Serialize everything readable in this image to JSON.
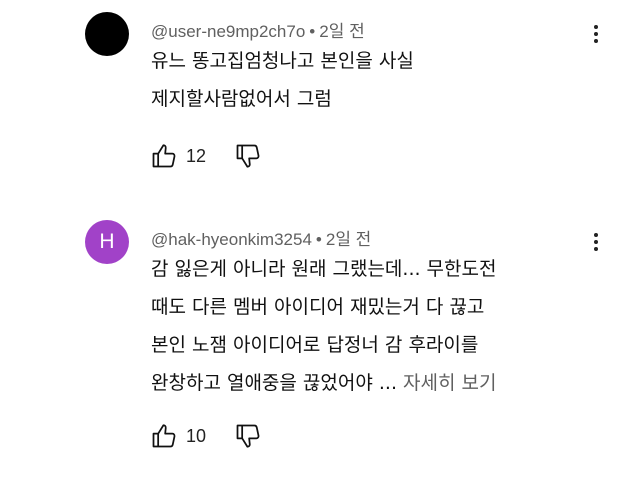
{
  "comments": [
    {
      "author": "@user-ne9mp2ch7o",
      "time": "2일 전",
      "avatar_color": "#000000",
      "avatar_letter": "",
      "lines": [
        "유느 똥고집엄청나고 본인을 사실",
        "제지할사람없어서 그럼"
      ],
      "more": "",
      "likes": "12"
    },
    {
      "author": "@hak-hyeonkim3254",
      "time": "2일 전",
      "avatar_color": "#a142c8",
      "avatar_letter": "H",
      "lines": [
        "감 잃은게 아니라 원래 그랬는데... 무한도전",
        "때도 다른 멤버 아이디어 재밌는거 다 끊고",
        "본인 노잼 아이디어로 답정너 감 후라이를",
        "완창하고 열애중을 끊었어야 ... "
      ],
      "more": "자세히 보기",
      "likes": "10"
    }
  ],
  "icons": {
    "like": "thumbs-up-icon",
    "dislike": "thumbs-down-icon",
    "menu": "more-vert-icon"
  },
  "meta_separator": "•"
}
